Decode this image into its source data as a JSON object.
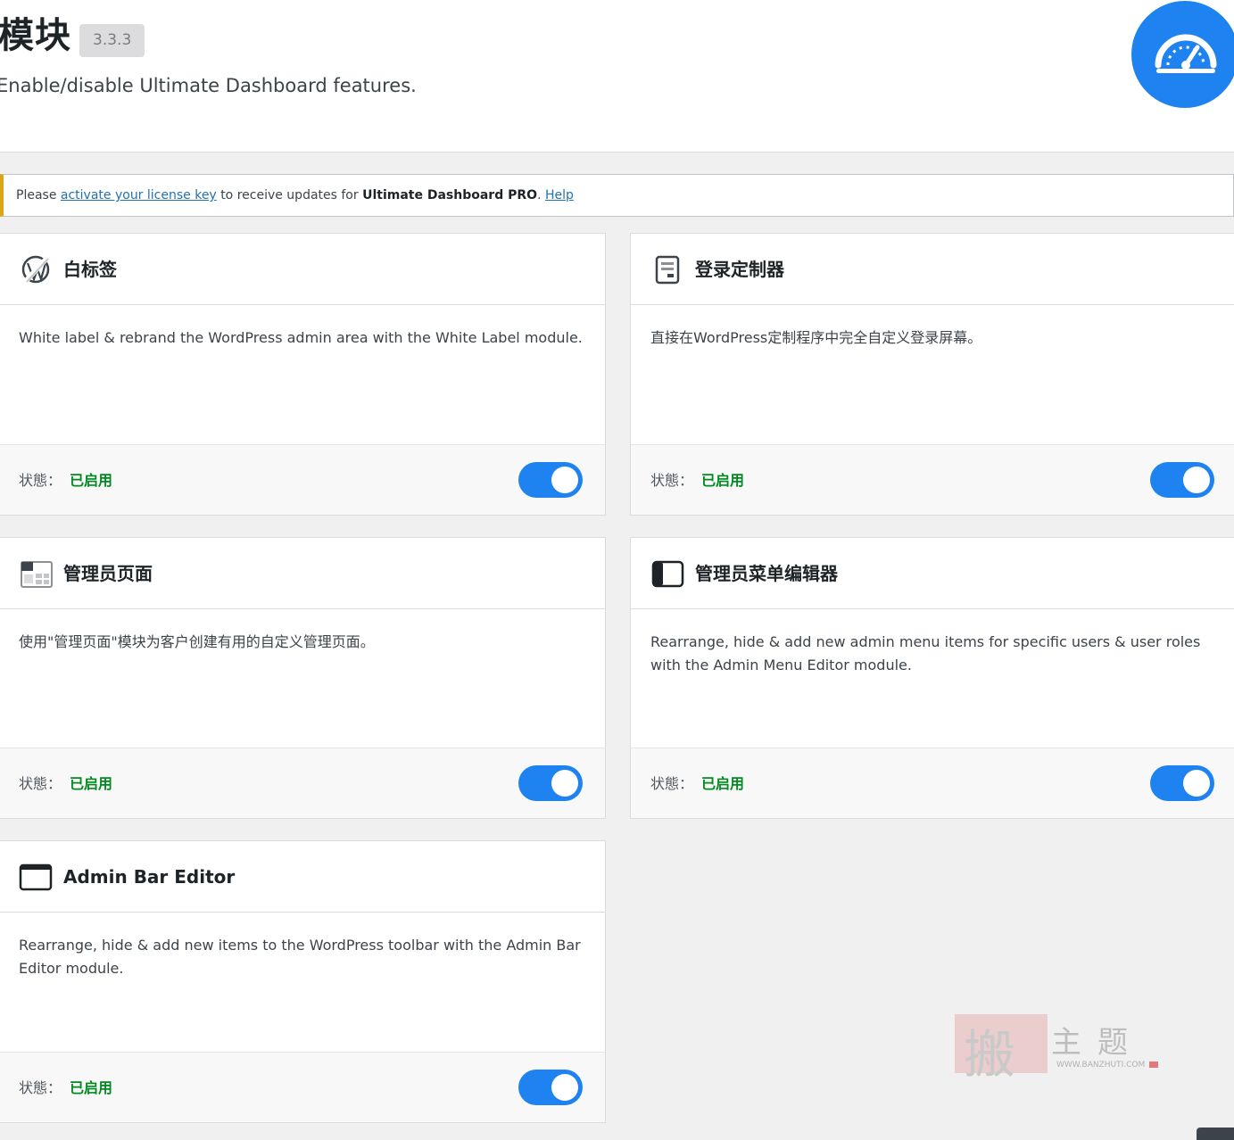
{
  "header": {
    "title": "模块",
    "version": "3.3.3",
    "subtitle": "Enable/disable Ultimate Dashboard features."
  },
  "notice": {
    "prefix": "Please",
    "link_text": "activate your license key",
    "middle": "to receive updates for",
    "product": "Ultimate Dashboard PRO",
    "period": ".",
    "help": "Help"
  },
  "modules": [
    {
      "title": "白标签",
      "description": "White label & rebrand the WordPress admin area with the White Label module.",
      "status_label": "状態：",
      "status_value": "已启用",
      "icon": "wordpress-icon",
      "enabled": true
    },
    {
      "title": "登录定制器",
      "description": "直接在WordPress定制程序中完全自定义登录屏幕。",
      "status_label": "状態：",
      "status_value": "已启用",
      "icon": "login-page-icon",
      "enabled": true
    },
    {
      "title": "管理员页面",
      "description": "使用\"管理页面\"模块为客户创建有用的自定义管理页面。",
      "status_label": "状態：",
      "status_value": "已启用",
      "icon": "admin-pages-icon",
      "enabled": true
    },
    {
      "title": "管理员菜单编辑器",
      "description": "Rearrange, hide & add new admin menu items for specific users & user roles with the Admin Menu Editor module.",
      "status_label": "状態：",
      "status_value": "已启用",
      "icon": "sidebar-layout-icon",
      "enabled": true
    },
    {
      "title": "Admin Bar Editor",
      "description": "Rearrange, hide & add new items to the WordPress toolbar with the Admin Bar Editor module.",
      "status_label": "状態：",
      "status_value": "已启用",
      "icon": "browser-window-icon",
      "enabled": true
    }
  ],
  "watermark": {
    "main": "搬",
    "text": "主题",
    "url": "WWW.BANZHUTI.COM"
  },
  "colors": {
    "accent": "#1e83f0",
    "status_enabled": "#008a20",
    "notice_border": "#dba617"
  }
}
